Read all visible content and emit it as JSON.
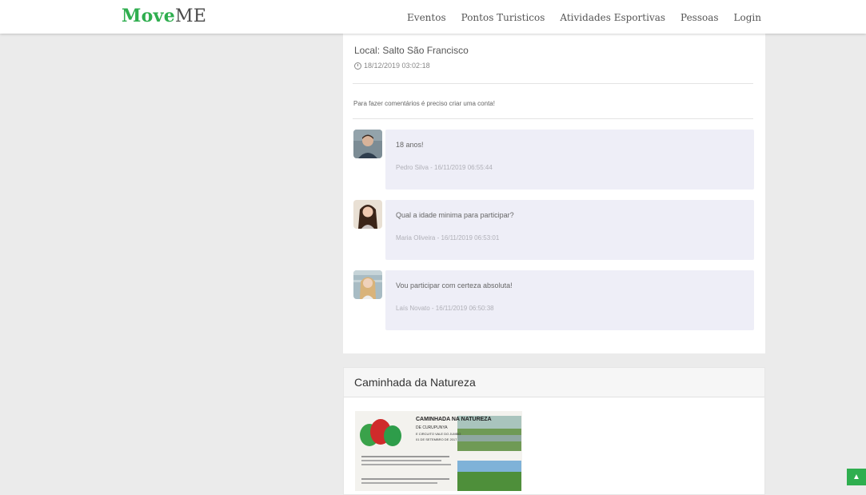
{
  "brand": {
    "part1": "Move",
    "part2": "ME"
  },
  "nav": {
    "items": [
      "Eventos",
      "Pontos Turisticos",
      "Atividades Esportivas",
      "Pessoas",
      "Login"
    ]
  },
  "event": {
    "local": "Local: Salto São Francisco",
    "datetime": "18/12/2019 03:02:18",
    "comment_notice": "Para fazer comentários é preciso criar uma conta!"
  },
  "comments": [
    {
      "text": "18 anos!",
      "meta": "Pedro Silva - 16/11/2019 06:55:44"
    },
    {
      "text": "Qual a idade minima para participar?",
      "meta": "Maria Oliveira - 16/11/2019 06:53:01"
    },
    {
      "text": "Vou participar com certeza absoluta!",
      "meta": "Laís Novato - 16/11/2019 06:50:38"
    }
  ],
  "next_event": {
    "title": "Caminhada da Natureza",
    "poster_heading": "CAMINHADA NA NATUREZA",
    "poster_lines": [
      "DE CURUPUNYA",
      "E CIRCUITO VALE DO JUMBO",
      "01 DE SETEMBRO DE 2017"
    ]
  },
  "colors": {
    "brand_green": "#2fae4f",
    "bubble": "#eeeef7",
    "background": "#ebebeb"
  },
  "icons": {
    "date": "clock-icon",
    "scroll_top": "chevron-up-icon"
  }
}
